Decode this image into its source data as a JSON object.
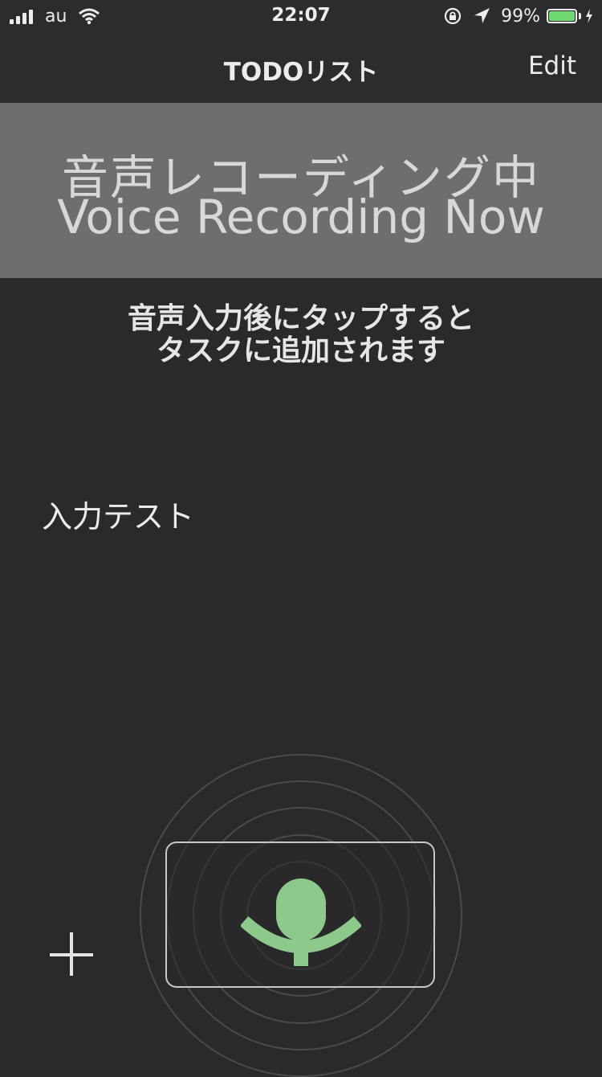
{
  "status_bar": {
    "carrier": "au",
    "time": "22:07",
    "battery_percent": "99%",
    "battery_level": 0.99,
    "icons": [
      "signal-icon",
      "wifi-icon",
      "orientation-lock-icon",
      "location-icon",
      "battery-icon",
      "charging-icon"
    ]
  },
  "nav": {
    "title": "TODOリスト",
    "edit_label": "Edit"
  },
  "banner": {
    "line_jp": "音声レコーディング中",
    "line_en": "Voice Recording Now",
    "background": "#6e6e6e"
  },
  "instruction": {
    "line1": "音声入力後にタップすると",
    "line2": "タスクに追加されます"
  },
  "recognized_text": "入力テスト",
  "controls": {
    "add_icon": "plus-icon",
    "mic_icon": "microphone-icon",
    "mic_color": "#8cc98a"
  }
}
